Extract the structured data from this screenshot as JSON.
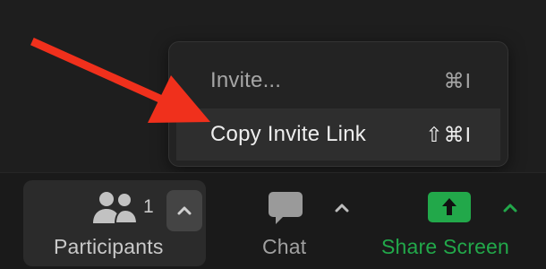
{
  "menu": {
    "items": [
      {
        "label": "Invite...",
        "shortcut": "⌘I"
      },
      {
        "label": "Copy Invite Link",
        "shortcut": "⇧⌘I"
      }
    ]
  },
  "toolbar": {
    "participants": {
      "label": "Participants",
      "count": "1"
    },
    "chat": {
      "label": "Chat"
    },
    "share_screen": {
      "label": "Share Screen"
    }
  },
  "colors": {
    "share_green": "#22a84a",
    "annotation_arrow": "#f0301c"
  },
  "icons": [
    "participants-icon",
    "chevron-up-icon",
    "chat-icon",
    "share-screen-icon",
    "annotation-arrow"
  ]
}
